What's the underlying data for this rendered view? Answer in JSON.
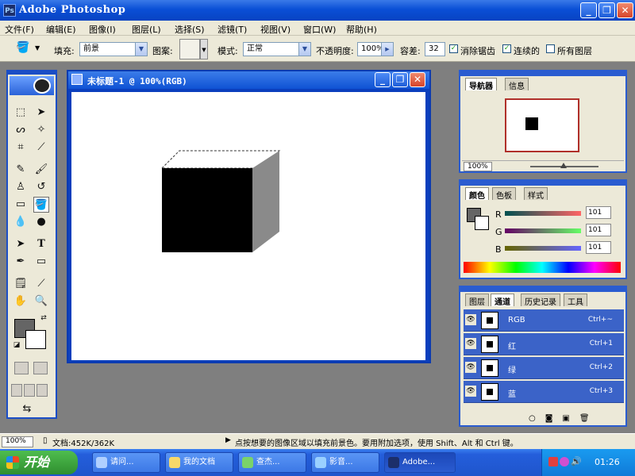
{
  "app": {
    "title": "Adobe Photoshop",
    "icon_name": "photoshop-icon"
  },
  "window_buttons": {
    "minimize": "_",
    "restore": "❐",
    "close": "✕"
  },
  "menu": [
    "文件(F)",
    "编辑(E)",
    "图像(I)",
    "图层(L)",
    "选择(S)",
    "滤镜(T)",
    "视图(V)",
    "窗口(W)",
    "帮助(H)"
  ],
  "options": {
    "fill_label": "填充:",
    "fill_value": "前景",
    "pattern_label": "图案:",
    "mode_label": "模式:",
    "mode_value": "正常",
    "opacity_label": "不透明度:",
    "opacity_value": "100%",
    "tolerance_label": "容差:",
    "tolerance_value": "32",
    "antialias_label": "消除锯齿",
    "antialias_checked": true,
    "contiguous_label": "连续的",
    "contiguous_checked": true,
    "all_layers_label": "所有图层",
    "all_layers_checked": false
  },
  "document": {
    "title": "未标题-1 @ 100%(RGB)"
  },
  "navigator": {
    "tabs": [
      "导航器",
      "信息"
    ],
    "zoom": "100%"
  },
  "color_panel": {
    "tabs": [
      "颜色",
      "色板",
      "样式"
    ],
    "channels": [
      {
        "label": "R",
        "value": "101"
      },
      {
        "label": "G",
        "value": "101"
      },
      {
        "label": "B",
        "value": "101"
      }
    ]
  },
  "channels_panel": {
    "tabs": [
      "图层",
      "通道",
      "历史记录",
      "工具"
    ],
    "rows": [
      {
        "name": "RGB",
        "shortcut": "Ctrl+~"
      },
      {
        "name": "红",
        "shortcut": "Ctrl+1"
      },
      {
        "name": "绿",
        "shortcut": "Ctrl+2"
      },
      {
        "name": "蓝",
        "shortcut": "Ctrl+3"
      }
    ]
  },
  "status": {
    "zoom": "100%",
    "doc_info": "文档:452K/362K",
    "hint": "点按想要的图像区域以填充前景色。要用附加选项，使用 Shift、Alt 和 Ctrl 键。"
  },
  "taskbar": {
    "start_label": "开始",
    "tasks": [
      "请问...",
      "我的文档",
      "查杰...",
      "影音...",
      "Adobe..."
    ],
    "clock": "01:26"
  }
}
